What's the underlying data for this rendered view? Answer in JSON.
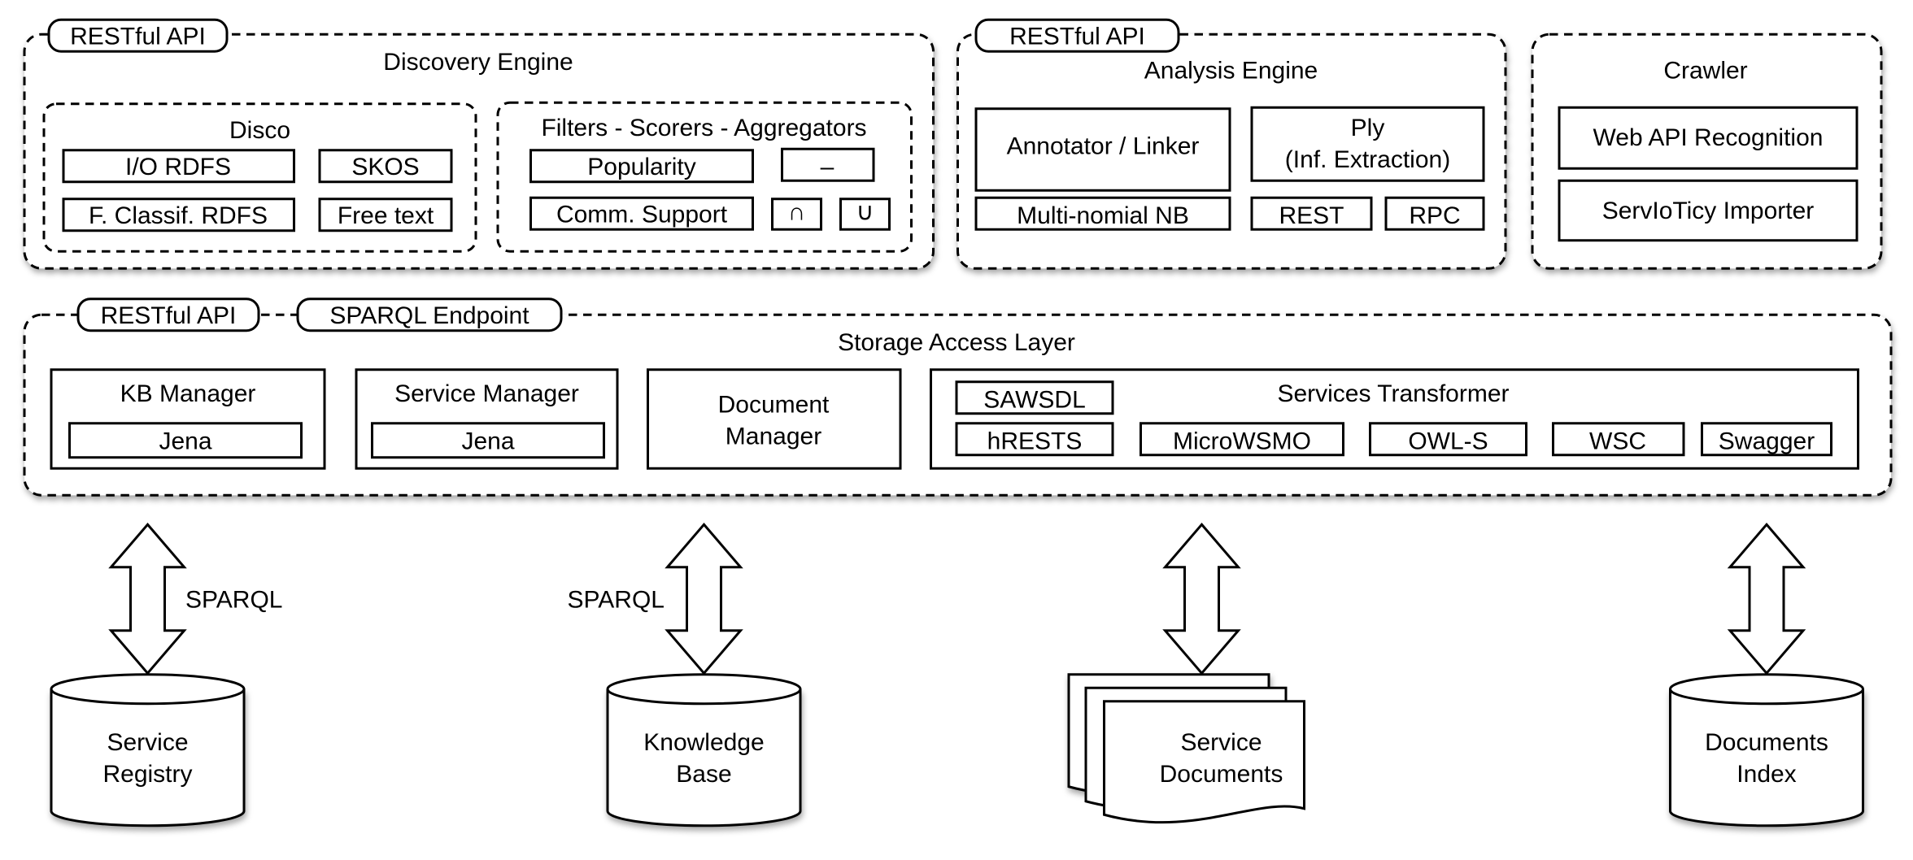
{
  "discovery_engine": {
    "tab": "RESTful API",
    "title": "Discovery Engine",
    "disco": {
      "title": "Disco",
      "items": [
        "I/O RDFS",
        "SKOS",
        "F. Classif. RDFS",
        "Free text"
      ]
    },
    "filters": {
      "title": "Filters - Scorers - Aggregators",
      "items": [
        "Popularity",
        "–",
        "Comm. Support",
        "∩",
        "∪"
      ]
    }
  },
  "analysis_engine": {
    "tab": "RESTful API",
    "title": "Analysis Engine",
    "items": [
      "Annotator / Linker",
      "Ply",
      "(Inf. Extraction)",
      "Multi-nomial NB",
      "REST",
      "RPC"
    ]
  },
  "crawler": {
    "title": "Crawler",
    "items": [
      "Web API Recognition",
      "ServIoTicy Importer"
    ]
  },
  "storage_layer": {
    "tabs": [
      "RESTful API",
      "SPARQL Endpoint"
    ],
    "title": "Storage Access Layer",
    "kb_manager": {
      "title": "KB Manager",
      "inner": "Jena"
    },
    "service_manager": {
      "title": "Service Manager",
      "inner": "Jena"
    },
    "document_manager": {
      "line1": "Document",
      "line2": "Manager"
    },
    "services_transformer": {
      "title": "Services Transformer",
      "items": [
        "SAWSDL",
        "hRESTS",
        "MicroWSMO",
        "OWL-S",
        "WSC",
        "Swagger"
      ]
    }
  },
  "connections": {
    "registry_label": "SPARQL",
    "kb_label": "SPARQL"
  },
  "stores": {
    "service_registry": [
      "Service",
      "Registry"
    ],
    "knowledge_base": [
      "Knowledge",
      "Base"
    ],
    "service_documents": [
      "Service",
      "Documents"
    ],
    "documents_index": [
      "Documents",
      "Index"
    ]
  }
}
